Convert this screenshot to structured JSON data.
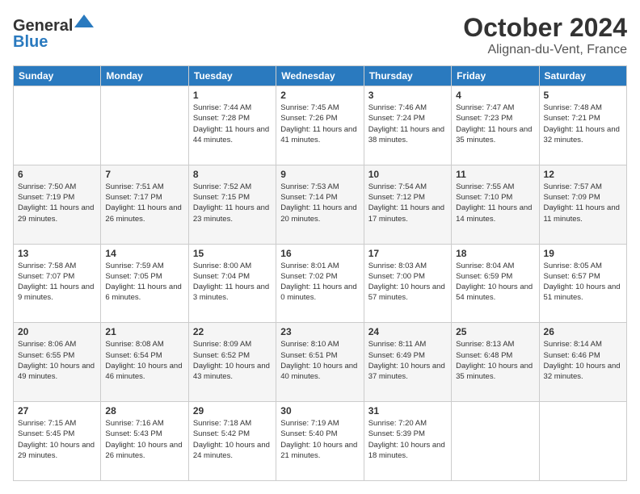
{
  "header": {
    "logo_line1": "General",
    "logo_line2": "Blue",
    "month": "October 2024",
    "location": "Alignan-du-Vent, France"
  },
  "weekdays": [
    "Sunday",
    "Monday",
    "Tuesday",
    "Wednesday",
    "Thursday",
    "Friday",
    "Saturday"
  ],
  "weeks": [
    [
      {
        "day": "",
        "sunrise": "",
        "sunset": "",
        "daylight": ""
      },
      {
        "day": "",
        "sunrise": "",
        "sunset": "",
        "daylight": ""
      },
      {
        "day": "1",
        "sunrise": "Sunrise: 7:44 AM",
        "sunset": "Sunset: 7:28 PM",
        "daylight": "Daylight: 11 hours and 44 minutes."
      },
      {
        "day": "2",
        "sunrise": "Sunrise: 7:45 AM",
        "sunset": "Sunset: 7:26 PM",
        "daylight": "Daylight: 11 hours and 41 minutes."
      },
      {
        "day": "3",
        "sunrise": "Sunrise: 7:46 AM",
        "sunset": "Sunset: 7:24 PM",
        "daylight": "Daylight: 11 hours and 38 minutes."
      },
      {
        "day": "4",
        "sunrise": "Sunrise: 7:47 AM",
        "sunset": "Sunset: 7:23 PM",
        "daylight": "Daylight: 11 hours and 35 minutes."
      },
      {
        "day": "5",
        "sunrise": "Sunrise: 7:48 AM",
        "sunset": "Sunset: 7:21 PM",
        "daylight": "Daylight: 11 hours and 32 minutes."
      }
    ],
    [
      {
        "day": "6",
        "sunrise": "Sunrise: 7:50 AM",
        "sunset": "Sunset: 7:19 PM",
        "daylight": "Daylight: 11 hours and 29 minutes."
      },
      {
        "day": "7",
        "sunrise": "Sunrise: 7:51 AM",
        "sunset": "Sunset: 7:17 PM",
        "daylight": "Daylight: 11 hours and 26 minutes."
      },
      {
        "day": "8",
        "sunrise": "Sunrise: 7:52 AM",
        "sunset": "Sunset: 7:15 PM",
        "daylight": "Daylight: 11 hours and 23 minutes."
      },
      {
        "day": "9",
        "sunrise": "Sunrise: 7:53 AM",
        "sunset": "Sunset: 7:14 PM",
        "daylight": "Daylight: 11 hours and 20 minutes."
      },
      {
        "day": "10",
        "sunrise": "Sunrise: 7:54 AM",
        "sunset": "Sunset: 7:12 PM",
        "daylight": "Daylight: 11 hours and 17 minutes."
      },
      {
        "day": "11",
        "sunrise": "Sunrise: 7:55 AM",
        "sunset": "Sunset: 7:10 PM",
        "daylight": "Daylight: 11 hours and 14 minutes."
      },
      {
        "day": "12",
        "sunrise": "Sunrise: 7:57 AM",
        "sunset": "Sunset: 7:09 PM",
        "daylight": "Daylight: 11 hours and 11 minutes."
      }
    ],
    [
      {
        "day": "13",
        "sunrise": "Sunrise: 7:58 AM",
        "sunset": "Sunset: 7:07 PM",
        "daylight": "Daylight: 11 hours and 9 minutes."
      },
      {
        "day": "14",
        "sunrise": "Sunrise: 7:59 AM",
        "sunset": "Sunset: 7:05 PM",
        "daylight": "Daylight: 11 hours and 6 minutes."
      },
      {
        "day": "15",
        "sunrise": "Sunrise: 8:00 AM",
        "sunset": "Sunset: 7:04 PM",
        "daylight": "Daylight: 11 hours and 3 minutes."
      },
      {
        "day": "16",
        "sunrise": "Sunrise: 8:01 AM",
        "sunset": "Sunset: 7:02 PM",
        "daylight": "Daylight: 11 hours and 0 minutes."
      },
      {
        "day": "17",
        "sunrise": "Sunrise: 8:03 AM",
        "sunset": "Sunset: 7:00 PM",
        "daylight": "Daylight: 10 hours and 57 minutes."
      },
      {
        "day": "18",
        "sunrise": "Sunrise: 8:04 AM",
        "sunset": "Sunset: 6:59 PM",
        "daylight": "Daylight: 10 hours and 54 minutes."
      },
      {
        "day": "19",
        "sunrise": "Sunrise: 8:05 AM",
        "sunset": "Sunset: 6:57 PM",
        "daylight": "Daylight: 10 hours and 51 minutes."
      }
    ],
    [
      {
        "day": "20",
        "sunrise": "Sunrise: 8:06 AM",
        "sunset": "Sunset: 6:55 PM",
        "daylight": "Daylight: 10 hours and 49 minutes."
      },
      {
        "day": "21",
        "sunrise": "Sunrise: 8:08 AM",
        "sunset": "Sunset: 6:54 PM",
        "daylight": "Daylight: 10 hours and 46 minutes."
      },
      {
        "day": "22",
        "sunrise": "Sunrise: 8:09 AM",
        "sunset": "Sunset: 6:52 PM",
        "daylight": "Daylight: 10 hours and 43 minutes."
      },
      {
        "day": "23",
        "sunrise": "Sunrise: 8:10 AM",
        "sunset": "Sunset: 6:51 PM",
        "daylight": "Daylight: 10 hours and 40 minutes."
      },
      {
        "day": "24",
        "sunrise": "Sunrise: 8:11 AM",
        "sunset": "Sunset: 6:49 PM",
        "daylight": "Daylight: 10 hours and 37 minutes."
      },
      {
        "day": "25",
        "sunrise": "Sunrise: 8:13 AM",
        "sunset": "Sunset: 6:48 PM",
        "daylight": "Daylight: 10 hours and 35 minutes."
      },
      {
        "day": "26",
        "sunrise": "Sunrise: 8:14 AM",
        "sunset": "Sunset: 6:46 PM",
        "daylight": "Daylight: 10 hours and 32 minutes."
      }
    ],
    [
      {
        "day": "27",
        "sunrise": "Sunrise: 7:15 AM",
        "sunset": "Sunset: 5:45 PM",
        "daylight": "Daylight: 10 hours and 29 minutes."
      },
      {
        "day": "28",
        "sunrise": "Sunrise: 7:16 AM",
        "sunset": "Sunset: 5:43 PM",
        "daylight": "Daylight: 10 hours and 26 minutes."
      },
      {
        "day": "29",
        "sunrise": "Sunrise: 7:18 AM",
        "sunset": "Sunset: 5:42 PM",
        "daylight": "Daylight: 10 hours and 24 minutes."
      },
      {
        "day": "30",
        "sunrise": "Sunrise: 7:19 AM",
        "sunset": "Sunset: 5:40 PM",
        "daylight": "Daylight: 10 hours and 21 minutes."
      },
      {
        "day": "31",
        "sunrise": "Sunrise: 7:20 AM",
        "sunset": "Sunset: 5:39 PM",
        "daylight": "Daylight: 10 hours and 18 minutes."
      },
      {
        "day": "",
        "sunrise": "",
        "sunset": "",
        "daylight": ""
      },
      {
        "day": "",
        "sunrise": "",
        "sunset": "",
        "daylight": ""
      }
    ]
  ]
}
